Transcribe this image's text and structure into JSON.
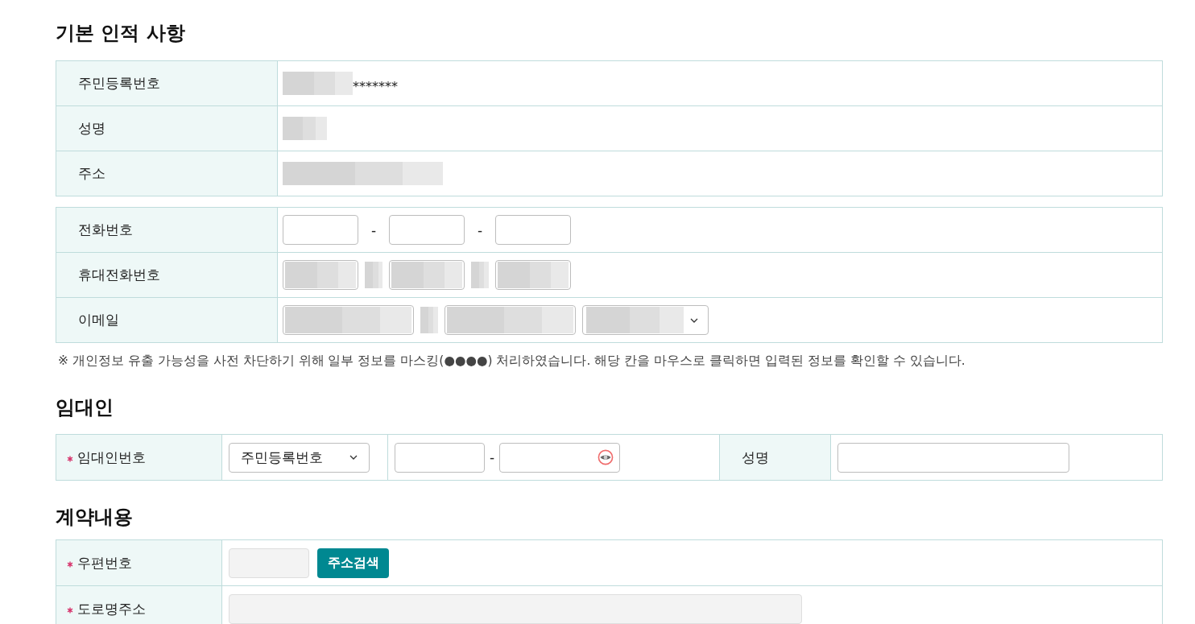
{
  "basic_info": {
    "title": "기본 인적 사항",
    "identity_rows": [
      {
        "label": "주민등록번호",
        "redacted": true,
        "value": "*******"
      },
      {
        "label": "성명",
        "redacted": true
      },
      {
        "label": "주소",
        "redacted": true
      }
    ],
    "contact_rows": [
      {
        "label": "전화번호",
        "kind": "phone",
        "fields": [
          {
            "kind": "input",
            "redacted": false
          },
          {
            "kind": "separator",
            "text": "-",
            "redacted": false
          },
          {
            "kind": "input",
            "redacted": false
          },
          {
            "kind": "separator",
            "text": "-",
            "redacted": false
          },
          {
            "kind": "input",
            "redacted": false
          }
        ]
      },
      {
        "label": "휴대전화번호",
        "kind": "phone",
        "fields": [
          {
            "kind": "input",
            "redacted": true
          },
          {
            "kind": "separator",
            "redacted": true
          },
          {
            "kind": "input",
            "redacted": true
          },
          {
            "kind": "separator",
            "redacted": true
          },
          {
            "kind": "input",
            "redacted": true
          }
        ]
      },
      {
        "label": "이메일",
        "kind": "email",
        "fields": [
          {
            "kind": "input",
            "redacted": true
          },
          {
            "kind": "separator",
            "redacted": true
          },
          {
            "kind": "input",
            "redacted": true
          },
          {
            "kind": "select",
            "redacted": true
          }
        ]
      }
    ],
    "notice": "※ 개인정보 유출 가능성을 사전 차단하기 위해 일부 정보를 마스킹(●●●●) 처리하였습니다. 해당 칸을 마우스로 클릭하면 입력된 정보를 확인할 수 있습니다."
  },
  "lessor": {
    "title": "임대인",
    "cells": [
      {
        "kind": "label",
        "text": "임대인번호",
        "required": true
      },
      {
        "kind": "select",
        "value": "주민등록번호"
      },
      {
        "kind": "id_number",
        "fields": [
          {
            "kind": "input",
            "reveal_toggle": false
          },
          {
            "kind": "separator",
            "text": "-"
          },
          {
            "kind": "input",
            "reveal_toggle": true
          }
        ]
      },
      {
        "kind": "label",
        "text": "성명",
        "required": false
      },
      {
        "kind": "input"
      }
    ]
  },
  "contract": {
    "title": "계약내용",
    "rows": [
      {
        "label": "우편번호",
        "required": true,
        "fields": [
          {
            "kind": "input",
            "disabled": true
          },
          {
            "kind": "button",
            "text": "주소검색"
          }
        ]
      },
      {
        "label": "도로명주소",
        "required": true,
        "fields": [
          {
            "kind": "wide_input",
            "disabled": true
          }
        ]
      }
    ]
  }
}
